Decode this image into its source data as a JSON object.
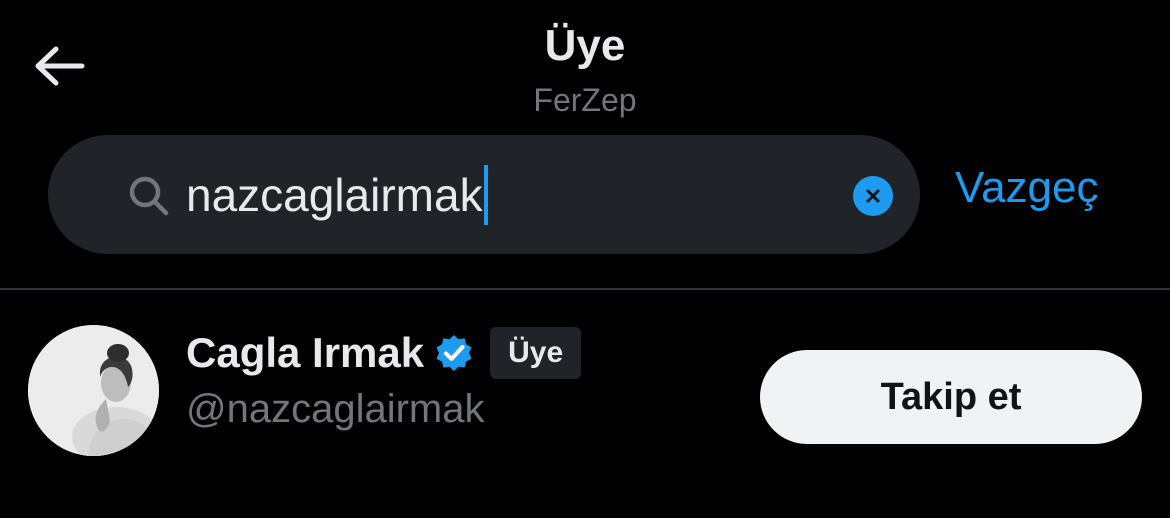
{
  "header": {
    "title": "Üye",
    "subtitle": "FerZep",
    "back_icon": "arrow-left-icon"
  },
  "search": {
    "value": "nazcaglairmak",
    "search_icon": "search-icon",
    "clear_icon": "clear-icon",
    "cancel_label": "Vazgeç"
  },
  "results": [
    {
      "display_name": "Cagla Irmak",
      "verified": true,
      "badge": "Üye",
      "handle": "@nazcaglairmak",
      "follow_label": "Takip et"
    }
  ],
  "colors": {
    "background": "#000000",
    "accent": "#1d9bf0",
    "text_primary": "#e7e9ea",
    "text_secondary": "#71767b",
    "search_bg": "#202327",
    "follow_button_bg": "#eff3f4"
  }
}
